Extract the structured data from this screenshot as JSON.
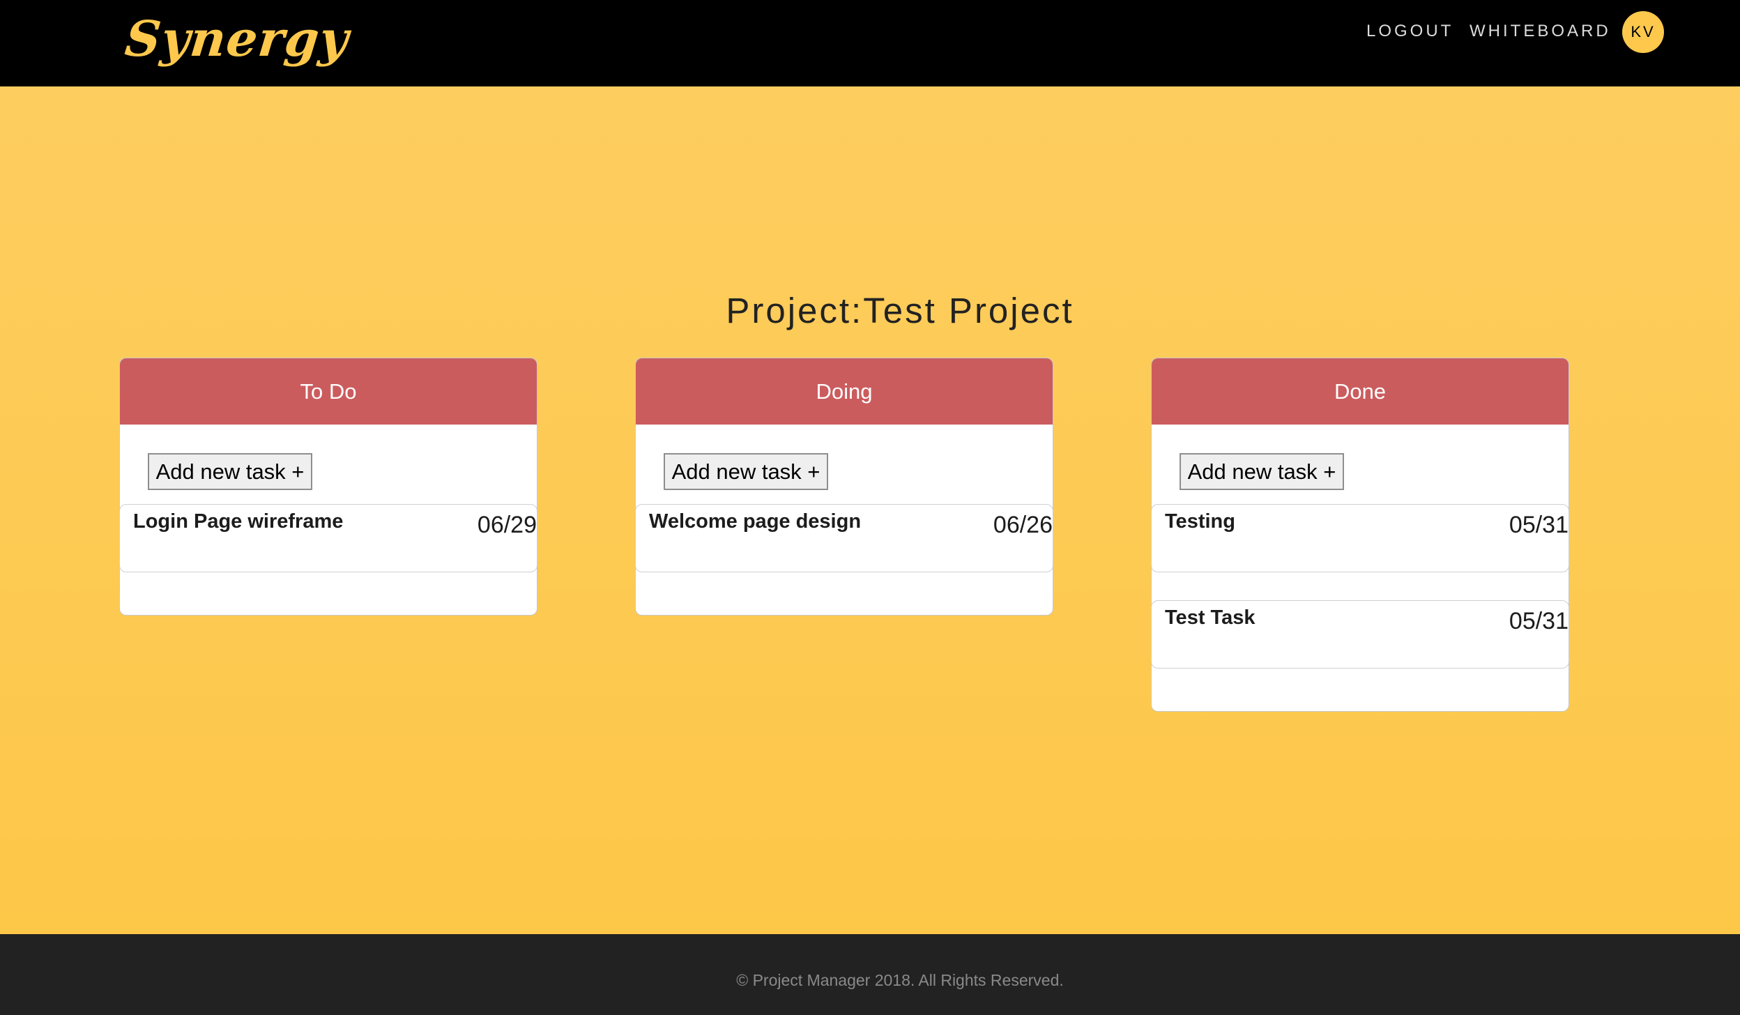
{
  "header": {
    "brand": "Synergy",
    "nav": {
      "logout": "LOGOUT",
      "whiteboard": "WHITEBOARD"
    },
    "avatar_initials": "KV"
  },
  "main": {
    "project_title": "Project:Test Project",
    "columns": [
      {
        "title": "To Do",
        "add_label": "Add new task +",
        "tasks": [
          {
            "name": "Login Page wireframe",
            "date": "06/29"
          }
        ]
      },
      {
        "title": "Doing",
        "add_label": "Add new task +",
        "tasks": [
          {
            "name": "Welcome page design",
            "date": "06/26"
          }
        ]
      },
      {
        "title": "Done",
        "add_label": "Add new task +",
        "tasks": [
          {
            "name": "Testing",
            "date": "05/31"
          },
          {
            "name": "Test Task",
            "date": "05/31"
          }
        ]
      }
    ]
  },
  "footer": {
    "copyright": "© Project Manager 2018. All Rights Reserved."
  },
  "colors": {
    "topbar": "#000000",
    "brand": "#fdc84c",
    "background": "#fdc84c",
    "column_header": "#cb5c5e",
    "footer": "#222222"
  }
}
